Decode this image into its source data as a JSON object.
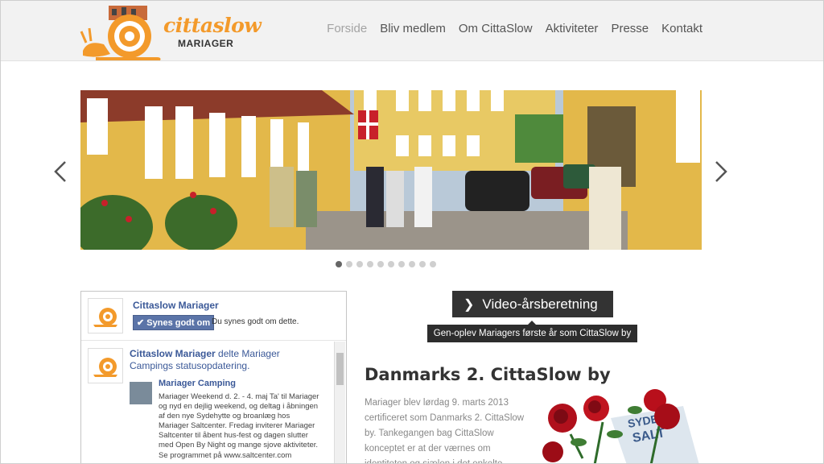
{
  "brand": {
    "logo_word": "cittaslow",
    "logo_sub": "MARIAGER",
    "accent": "#f39a2b"
  },
  "nav": {
    "items": [
      {
        "label": "Forside",
        "active": true
      },
      {
        "label": "Bliv medlem",
        "active": false
      },
      {
        "label": "Om CittaSlow",
        "active": false
      },
      {
        "label": "Aktiviteter",
        "active": false
      },
      {
        "label": "Presse",
        "active": false
      },
      {
        "label": "Kontakt",
        "active": false
      }
    ]
  },
  "slider": {
    "prev_icon": "chevron-left-icon",
    "next_icon": "chevron-right-icon",
    "slide_count": 10,
    "active_index": 0
  },
  "facebook": {
    "page_name": "Cittaslow Mariager",
    "like_label": "Synes godt om",
    "like_text": "Du synes godt om dette.",
    "post": {
      "author": "Cittaslow Mariager",
      "action": "delte Mariager Campings statusopdatering.",
      "shared_name": "Mariager Camping",
      "shared_text": "Mariager Weekend d. 2. - 4. maj Ta' til Mariager og nyd en dejlig weekend, og deltag i åbningen af den nye Sydehytte og broanlæg hos Mariager Saltcenter. Fredag inviterer Mariager Saltcenter til åbent hus-fest og dagen slutter med Open By Night og mange sjove aktiviteter. Se programmet på www.saltcenter.com"
    }
  },
  "video": {
    "button_label": "Video-årsberetning",
    "tooltip": "Gen-oplev Mariagers første år som CittaSlow by"
  },
  "article": {
    "heading": "Danmarks 2. CittaSlow by",
    "body": "Mariager blev lørdag 9. marts 2013 certificeret som Danmarks 2. CittaSlow by. Tankegangen bag CittaSlow konceptet er at der værnes om identiteten og sjælen i det enkelte"
  }
}
